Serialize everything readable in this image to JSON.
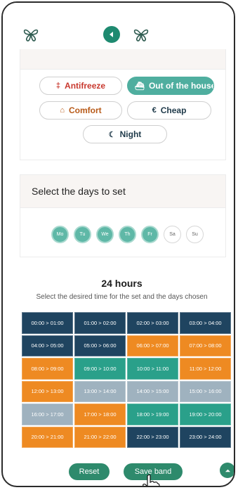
{
  "modes": [
    {
      "label": "Antifreeze",
      "icon": "thermometer-icon",
      "glyph": "‡",
      "active": false
    },
    {
      "label": "Out of the house",
      "icon": "car-icon",
      "glyph": "⛴",
      "active": true
    },
    {
      "label": "Comfort",
      "icon": "sofa-icon",
      "glyph": "⌂",
      "active": false
    },
    {
      "label": "Cheap",
      "icon": "euro-icon",
      "glyph": "€",
      "active": false
    },
    {
      "label": "Night",
      "icon": "moon-icon",
      "glyph": "☾",
      "active": false
    }
  ],
  "days_section": {
    "title": "Select the days to set",
    "days": [
      {
        "label": "Mo",
        "selected": true
      },
      {
        "label": "Tu",
        "selected": true
      },
      {
        "label": "We",
        "selected": true
      },
      {
        "label": "Th",
        "selected": true
      },
      {
        "label": "Fr",
        "selected": true
      },
      {
        "label": "Sa",
        "selected": false
      },
      {
        "label": "Su",
        "selected": false
      }
    ]
  },
  "hours": {
    "title": "24 hours",
    "subtitle": "Select the desired time for the set and the days chosen",
    "slots": [
      {
        "label": "00:00 > 01:00",
        "mode": "night"
      },
      {
        "label": "01:00 > 02:00",
        "mode": "night"
      },
      {
        "label": "02:00 > 03:00",
        "mode": "night"
      },
      {
        "label": "03:00 > 04:00",
        "mode": "night"
      },
      {
        "label": "04:00 > 05:00",
        "mode": "night"
      },
      {
        "label": "05:00 > 06:00",
        "mode": "night"
      },
      {
        "label": "06:00 > 07:00",
        "mode": "comfort"
      },
      {
        "label": "07:00 > 08:00",
        "mode": "comfort"
      },
      {
        "label": "08:00 > 09:00",
        "mode": "comfort"
      },
      {
        "label": "09:00 > 10:00",
        "mode": "away"
      },
      {
        "label": "10:00 > 11:00",
        "mode": "away"
      },
      {
        "label": "11:00 > 12:00",
        "mode": "comfort"
      },
      {
        "label": "12:00 > 13:00",
        "mode": "comfort"
      },
      {
        "label": "13:00 > 14:00",
        "mode": "cheap"
      },
      {
        "label": "14:00 > 15:00",
        "mode": "cheap"
      },
      {
        "label": "15:00 > 16:00",
        "mode": "cheap"
      },
      {
        "label": "16:00 > 17:00",
        "mode": "cheap"
      },
      {
        "label": "17:00 > 18:00",
        "mode": "comfort"
      },
      {
        "label": "18:00 > 19:00",
        "mode": "away"
      },
      {
        "label": "19:00 > 20:00",
        "mode": "away"
      },
      {
        "label": "20:00 > 21:00",
        "mode": "comfort"
      },
      {
        "label": "21:00 > 22:00",
        "mode": "comfort"
      },
      {
        "label": "22:00 > 23:00",
        "mode": "night"
      },
      {
        "label": "23:00 > 24:00",
        "mode": "night"
      }
    ]
  },
  "slot_colors": {
    "night": "#1f4460",
    "comfort": "#ee8a22",
    "away": "#2aa08a",
    "cheap": "#9fb2bf"
  },
  "actions": {
    "reset_label": "Reset",
    "save_label": "Save band"
  },
  "colors": {
    "brand_green": "#2e8a6c",
    "active_mode": "#4fae9f"
  }
}
